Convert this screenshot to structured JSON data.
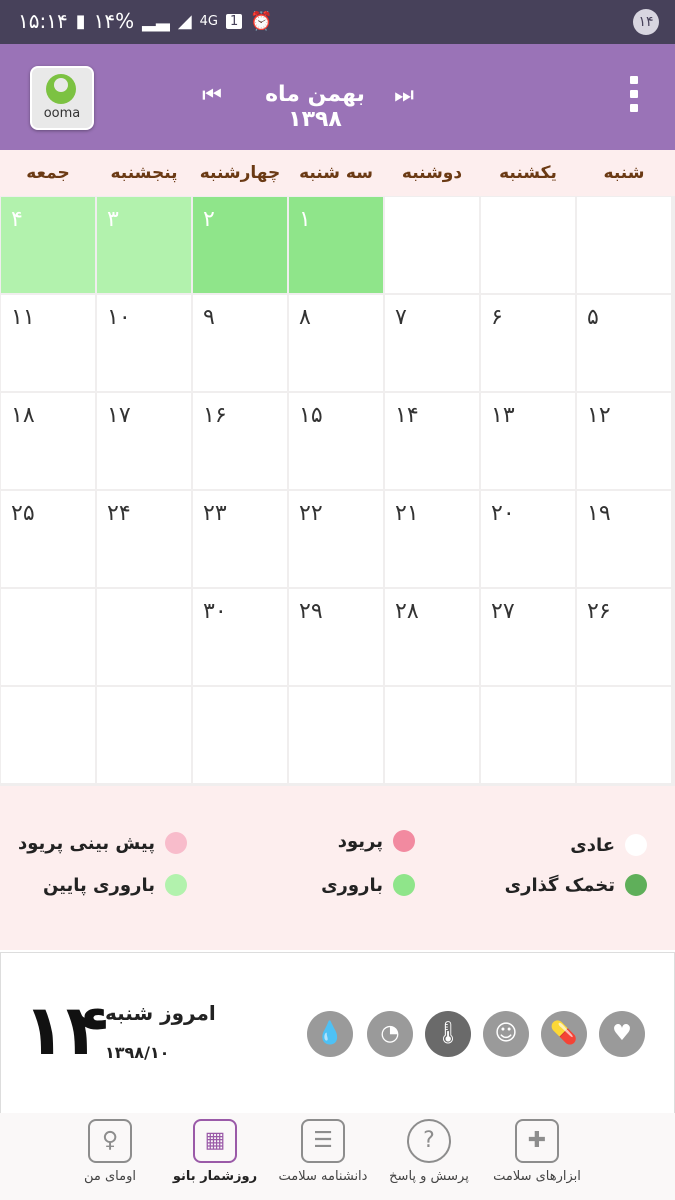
{
  "statusbar": {
    "time": "۱۵:۱۴",
    "battery": "۱۴%",
    "network": "4G",
    "sim_slot": "1",
    "notification_count": "۱۴"
  },
  "header": {
    "month_title": "بهمن ماه ۱۳۹۸",
    "logo_text": "ooma",
    "prev_icon": "skip-previous-icon",
    "next_icon": "skip-next-icon"
  },
  "weekdays": [
    "شنبه",
    "یکشنبه",
    "دوشنبه",
    "سه شنبه",
    "چهارشنبه",
    "پنجشنبه",
    "جمعه"
  ],
  "calendar": {
    "rows": [
      [
        "",
        "",
        "",
        "۱",
        "۲",
        "۳",
        "۴"
      ],
      [
        "۵",
        "۶",
        "۷",
        "۸",
        "۹",
        "۱۰",
        "۱۱"
      ],
      [
        "۱۲",
        "۱۳",
        "۱۴",
        "۱۵",
        "۱۶",
        "۱۷",
        "۱۸"
      ],
      [
        "۱۹",
        "۲۰",
        "۲۱",
        "۲۲",
        "۲۳",
        "۲۴",
        "۲۵"
      ],
      [
        "۲۶",
        "۲۷",
        "۲۸",
        "۲۹",
        "۳۰",
        "",
        ""
      ],
      [
        "",
        "",
        "",
        "",
        "",
        "",
        ""
      ]
    ],
    "highlights": {
      "fertile_days": [
        "۱",
        "۲"
      ],
      "low_fertility_days": [
        "۳",
        "۴"
      ]
    }
  },
  "legend": [
    {
      "label": "عادی",
      "color": "#ffffff"
    },
    {
      "label": "پریود",
      "color": "#f28aa0"
    },
    {
      "label": "پیش بینی پریود",
      "color": "#f8bccb"
    },
    {
      "label": "تخمک گذاری",
      "color": "#5faf5a"
    },
    {
      "label": "باروری",
      "color": "#8fe58a"
    },
    {
      "label": "باروری پایین",
      "color": "#b2f2ad"
    }
  ],
  "today": {
    "day_number": "۱۴",
    "label": "امروز شنبه",
    "date": "۱۳۹۸/۱۰"
  },
  "tools": [
    "heart-icon",
    "pill-icon",
    "smiley-icon",
    "thermometer-icon",
    "scale-icon",
    "drop-icon"
  ],
  "bottom_nav": [
    {
      "label": "ابزارهای سلامت",
      "icon": "medical-kit-icon"
    },
    {
      "label": "پرسش و پاسخ",
      "icon": "question-bubble-icon"
    },
    {
      "label": "دانشنامه سلامت",
      "icon": "newspaper-icon"
    },
    {
      "label": "روزشمار بانو",
      "icon": "calendar-icon"
    },
    {
      "label": "اومای من",
      "icon": "woman-profile-icon"
    }
  ],
  "colors": {
    "header": "#9a73b7",
    "statusbar": "#47415a",
    "weekday_text": "#6b3a14",
    "active_nav": "#9a5aa8"
  }
}
